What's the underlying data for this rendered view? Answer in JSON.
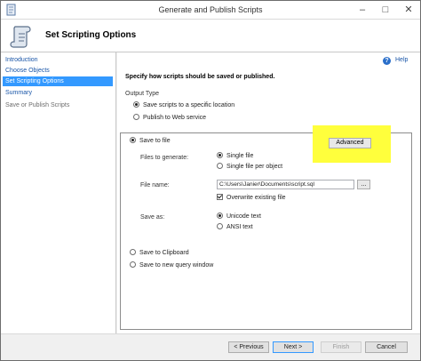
{
  "window": {
    "title": "Generate and Publish Scripts"
  },
  "header": {
    "title": "Set Scripting Options"
  },
  "sidebar": {
    "items": [
      {
        "label": "Introduction"
      },
      {
        "label": "Choose Objects"
      },
      {
        "label": "Set Scripting Options"
      },
      {
        "label": "Summary"
      },
      {
        "label": "Save or Publish Scripts"
      }
    ]
  },
  "help": {
    "label": "Help"
  },
  "main": {
    "instruction": "Specify how scripts should be saved or published.",
    "output_type": {
      "label": "Output Type",
      "options": [
        {
          "label": "Save scripts to a specific location",
          "selected": true
        },
        {
          "label": "Publish to Web service",
          "selected": false
        }
      ]
    },
    "save_to_file": {
      "label": "Save to file",
      "selected": true
    },
    "advanced_button": "Advanced",
    "files_to_generate": {
      "label": "Files to generate:",
      "options": [
        {
          "label": "Single file",
          "selected": true
        },
        {
          "label": "Single file per object",
          "selected": false
        }
      ]
    },
    "file_name": {
      "label": "File name:",
      "value": "C:\\Users\\Janier\\Documents\\script.sql",
      "browse": "..."
    },
    "overwrite": {
      "label": "Overwrite existing file",
      "checked": true
    },
    "save_as": {
      "label": "Save as:",
      "options": [
        {
          "label": "Unicode text",
          "selected": true
        },
        {
          "label": "ANSI text",
          "selected": false
        }
      ]
    },
    "save_to_clipboard": {
      "label": "Save to Clipboard",
      "selected": false
    },
    "save_to_query_window": {
      "label": "Save to new query window",
      "selected": false
    }
  },
  "footer": {
    "previous": "< Previous",
    "next": "Next >",
    "finish": "Finish",
    "cancel": "Cancel"
  },
  "colors": {
    "highlight": "#ffff3c",
    "selection": "#3399ff",
    "link": "#1a56a8"
  }
}
